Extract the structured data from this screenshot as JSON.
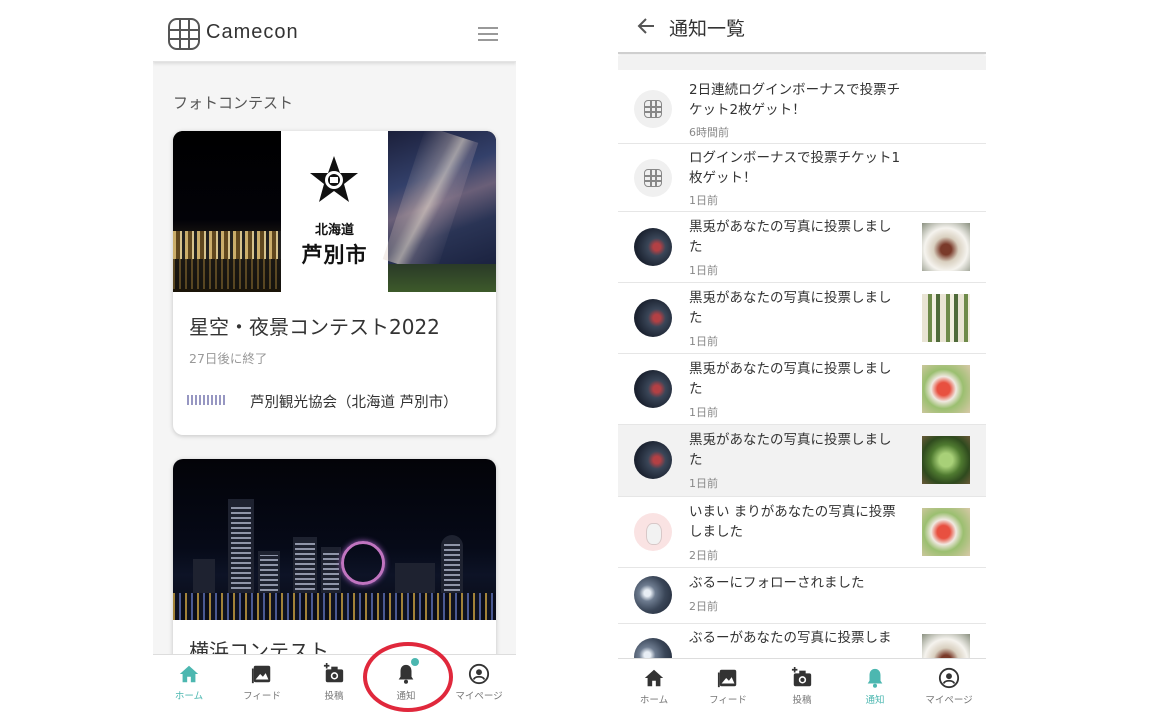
{
  "left": {
    "app_title": "Camecon",
    "section_title": "フォトコンテスト",
    "contests": [
      {
        "banner_pref": "北海道",
        "banner_city": "芦別市",
        "title": "星空・夜景コンテスト2022",
        "status": "27日後に終了",
        "organizer": "芦別観光協会（北海道 芦別市）"
      },
      {
        "title": "横浜コンテスト"
      }
    ],
    "nav": [
      {
        "label": "ホーム",
        "icon": "home-icon",
        "active": true
      },
      {
        "label": "フィード",
        "icon": "feed-icon"
      },
      {
        "label": "投稿",
        "icon": "camera-plus-icon"
      },
      {
        "label": "通知",
        "icon": "bell-icon",
        "badge": true
      },
      {
        "label": "マイページ",
        "icon": "user-icon"
      }
    ],
    "accent_color": "#4cb7b0",
    "highlight_color": "#e0283c"
  },
  "right": {
    "page_title": "通知一覧",
    "notifications": [
      {
        "text": "2日連続ログインボーナスで投票チケット2枚ゲット！",
        "time": "6時間前",
        "avatar": "app-logo"
      },
      {
        "text": "ログインボーナスで投票チケット1枚ゲット！",
        "time": "1日前",
        "avatar": "app-logo"
      },
      {
        "text": "黒兎があなたの写真に投票しました",
        "time": "1日前",
        "avatar": "user-dark",
        "thumb": "food-plate"
      },
      {
        "text": "黒兎があなたの写真に投票しました",
        "time": "1日前",
        "avatar": "user-dark",
        "thumb": "sandwich"
      },
      {
        "text": "黒兎があなたの写真に投票しました",
        "time": "1日前",
        "avatar": "user-dark",
        "thumb": "salad-bowl"
      },
      {
        "text": "黒兎があなたの写真に投票しました",
        "time": "1日前",
        "avatar": "user-dark",
        "thumb": "green-dish"
      },
      {
        "text": "いまい まりがあなたの写真に投票しました",
        "time": "2日前",
        "avatar": "user-cat",
        "thumb": "salad-bowl"
      },
      {
        "text": "ぶるーにフォローされました",
        "time": "2日前",
        "avatar": "user-moon"
      },
      {
        "text": "ぶるーがあなたの写真に投票しま",
        "time": "",
        "avatar": "user-moon",
        "thumb": "food-plate"
      }
    ],
    "nav": [
      {
        "label": "ホーム",
        "icon": "home-icon"
      },
      {
        "label": "フィード",
        "icon": "feed-icon"
      },
      {
        "label": "投稿",
        "icon": "camera-plus-icon"
      },
      {
        "label": "通知",
        "icon": "bell-icon",
        "active": true
      },
      {
        "label": "マイページ",
        "icon": "user-icon"
      }
    ]
  }
}
